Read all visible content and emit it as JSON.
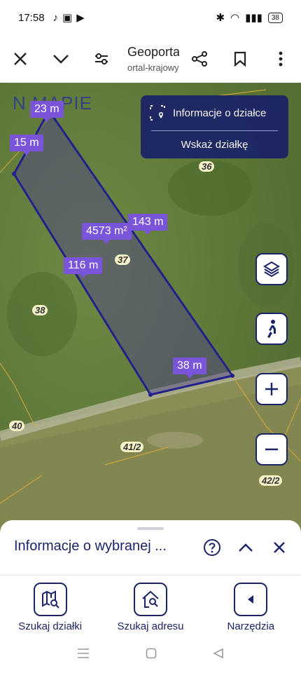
{
  "status_bar": {
    "time": "17:58",
    "battery": "38"
  },
  "browser": {
    "title": "Geoportal...",
    "url": "ortal-krajowy.pl"
  },
  "map": {
    "logo_text": "N  MAPIE",
    "info_panel": {
      "title": "Informacje o działce",
      "action": "Wskaż działkę"
    },
    "measurements": {
      "top": "23 m",
      "left_short": "15 m",
      "right_long": "143 m",
      "area": "4573 m²",
      "left_long": "116 m",
      "bottom": "38 m"
    },
    "parcels": [
      "36",
      "37",
      "38",
      "40",
      "41/2",
      "42/2"
    ]
  },
  "sheet": {
    "title": "Informacje o wybranej ..."
  },
  "bottom_nav": [
    {
      "label": "Szukaj działki",
      "icon": "map-search-icon"
    },
    {
      "label": "Szukaj adresu",
      "icon": "home-search-icon"
    },
    {
      "label": "Narzędzia",
      "icon": "chevron-left-icon"
    }
  ],
  "colors": {
    "primary": "#1b2466",
    "measure": "#7b55d9",
    "parcel_line": "#22208a"
  }
}
